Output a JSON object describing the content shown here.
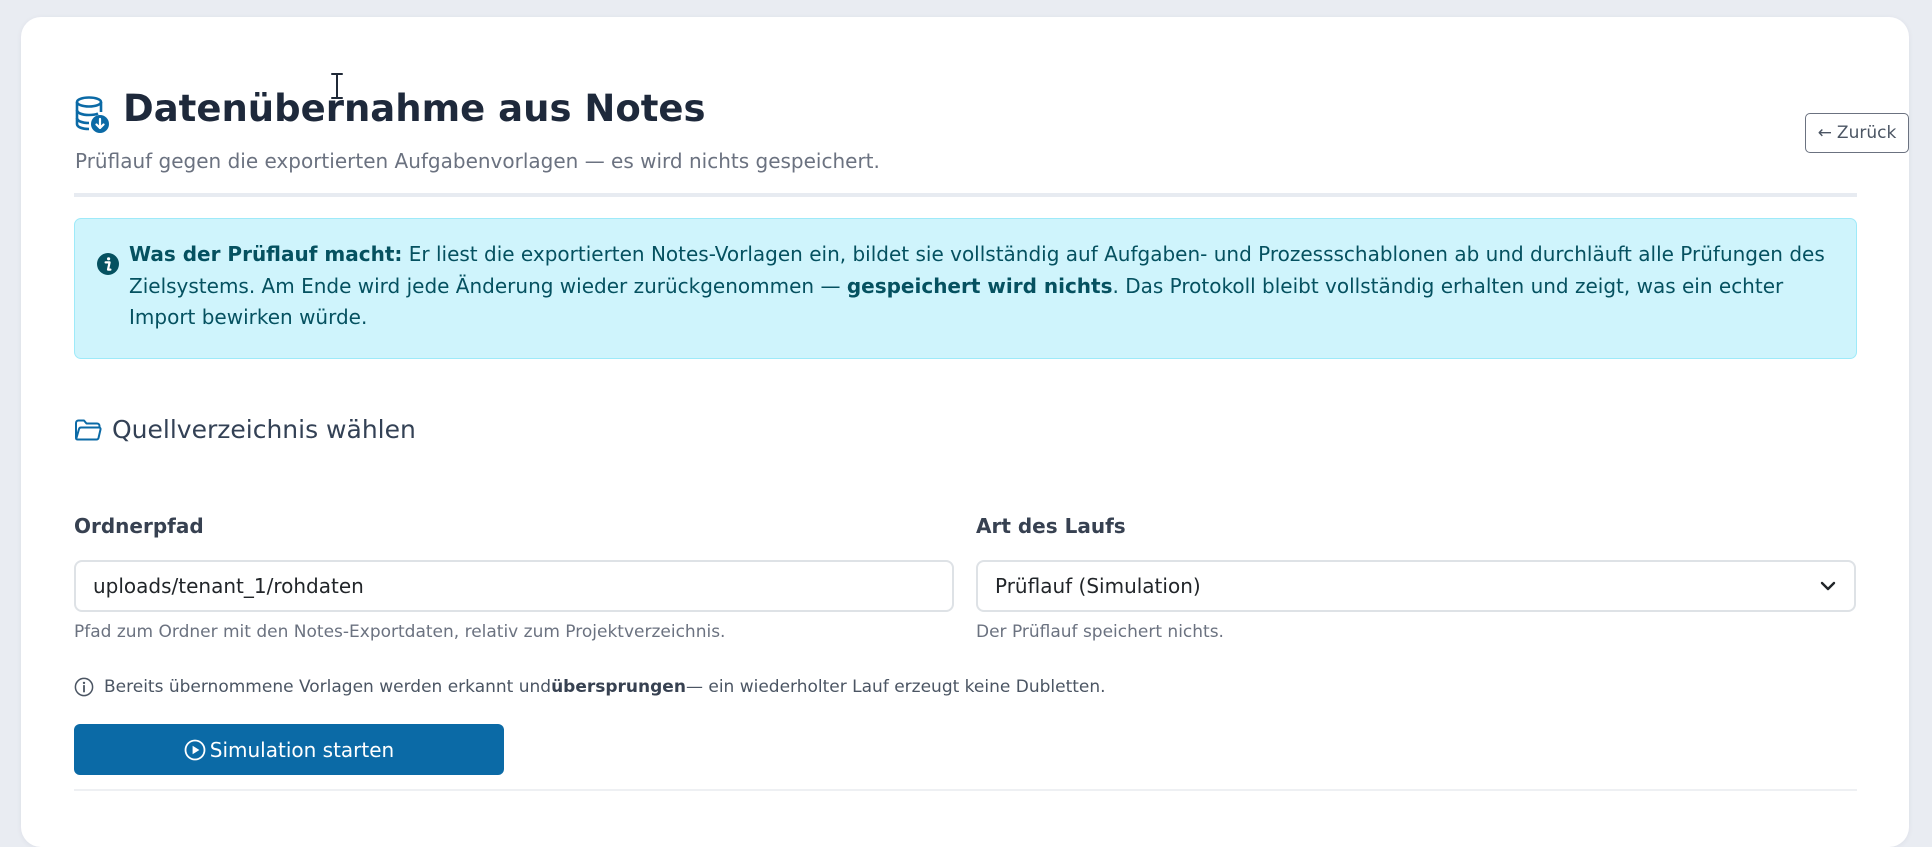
{
  "header": {
    "icon": "database-download-icon",
    "title": "Datenübernahme aus Notes",
    "subtitle": "Prüflauf gegen die exportierten Aufgabenvorlagen — es wird nichts gespeichert.",
    "back_button": {
      "icon": "arrow-left-icon",
      "arrow": "←",
      "label": "Zurück"
    }
  },
  "info": {
    "icon": "info-circle-icon",
    "lead_bold": "Was der Prüflauf macht:",
    "text_1": " Er liest die exportierten Notes-Vorlagen ein, bildet sie vollständig auf Aufgaben- und Prozessschablonen ab und durchläuft alle Prüfungen des Zielsystems. Am Ende wird jede Änderung wieder zurückgenommen — ",
    "emphasis_bold": "gespeichert wird nichts",
    "text_2": ". Das Protokoll bleibt vollständig erhalten und zeigt, was ein echter Import bewirken würde."
  },
  "section": {
    "icon": "folder-icon",
    "title": "Quellverzeichnis wählen"
  },
  "form": {
    "folder_path": {
      "label": "Ordnerpfad",
      "value": "uploads/tenant_1/rohdaten",
      "help": "Pfad zum Ordner mit den Notes-Exportdaten, relativ zum Projektverzeichnis."
    },
    "run_type": {
      "label": "Art des Laufs",
      "selected": "Prüflauf (Simulation)",
      "help": "Der Prüflauf speichert nichts."
    }
  },
  "note": {
    "icon": "info-outline-icon",
    "text_1": "Bereits übernommene Vorlagen werden erkannt und ",
    "bold": "übersprungen",
    "text_2": " — ein wiederholter Lauf erzeugt keine Dubletten."
  },
  "actions": {
    "start_icon": "play-circle-icon",
    "start_label": "Simulation starten"
  },
  "colors": {
    "primary": "#0b6aa6",
    "info_background": "#cff4fc",
    "info_text": "#055160",
    "title": "#1e293b",
    "page_background": "#e9ecf2"
  }
}
